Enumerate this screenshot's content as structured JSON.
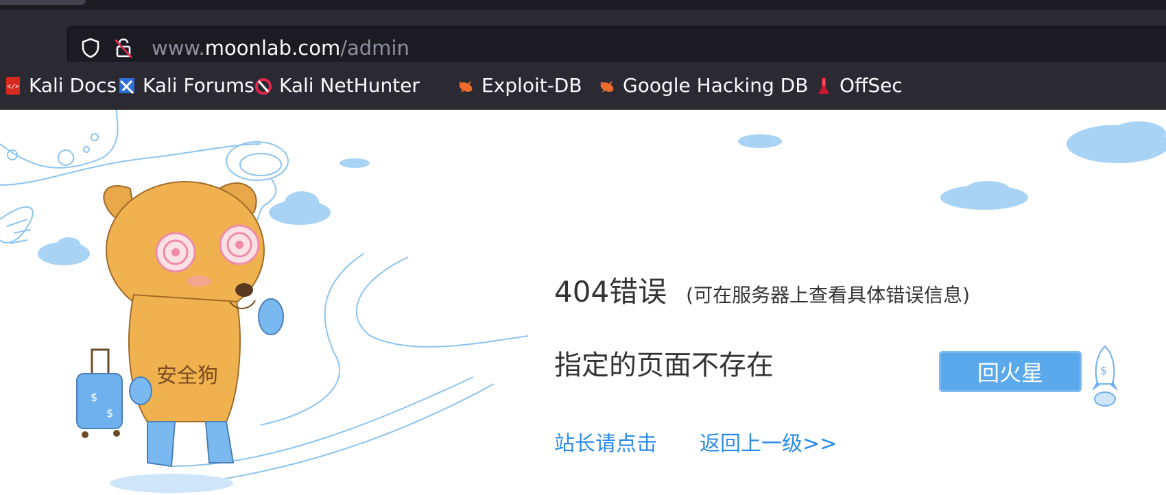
{
  "browser": {
    "url_prefix": "www.",
    "url_host": "moonlab.com",
    "url_path": "/admin",
    "bookmarks": [
      {
        "label": "Kali Docs",
        "icon": "kali-docs-icon"
      },
      {
        "label": "Kali Forums",
        "icon": "kali-forums-icon"
      },
      {
        "label": "Kali NetHunter",
        "icon": "kali-nethunter-icon"
      },
      {
        "label": "Exploit-DB",
        "icon": "exploit-db-icon"
      },
      {
        "label": "Google Hacking DB",
        "icon": "google-hacking-db-icon"
      },
      {
        "label": "OffSec",
        "icon": "offsec-icon"
      }
    ]
  },
  "page": {
    "error_code": "404错误",
    "error_hint": "(可在服务器上查看具体错误信息)",
    "message": "指定的页面不存在",
    "back_button": "回火星",
    "dog_label": "安全狗",
    "link_admin": "站长请点击",
    "link_back": "返回上一级>>"
  },
  "colors": {
    "chrome_bg": "#2b2a33",
    "urlbar_bg": "#1c1b22",
    "link_blue": "#2b8ce8",
    "button_blue": "#5aa9ec",
    "dog_orange": "#f0b24f",
    "cloud_blue": "#a9d3f5"
  }
}
